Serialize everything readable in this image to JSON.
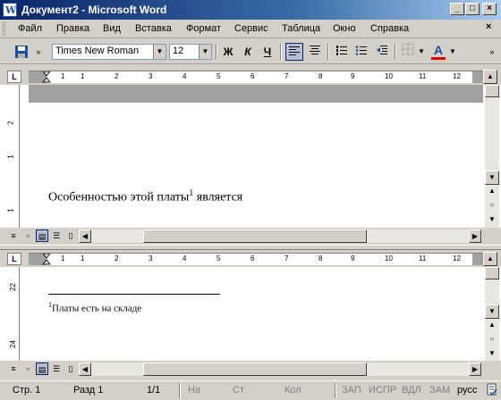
{
  "window": {
    "title": "Документ2 - Microsoft Word",
    "app_icon_letter": "W",
    "minimize": "_",
    "maximize": "□",
    "close": "×"
  },
  "menu": {
    "items": [
      {
        "label": "Файл"
      },
      {
        "label": "Правка"
      },
      {
        "label": "Вид"
      },
      {
        "label": "Вставка"
      },
      {
        "label": "Формат"
      },
      {
        "label": "Сервис"
      },
      {
        "label": "Таблица"
      },
      {
        "label": "Окно"
      },
      {
        "label": "Справка"
      }
    ],
    "close_doc": "×"
  },
  "toolbar": {
    "font_name": "Times New Roman",
    "font_size": "12",
    "bold": "Ж",
    "italic": "К",
    "underline": "Ч",
    "font_color": "A",
    "font_color_hex": "#e00000"
  },
  "ruler": {
    "tab_marker": "L",
    "numbers": [
      "1",
      "1",
      "2",
      "3",
      "4",
      "5",
      "6",
      "7",
      "8",
      "9",
      "10",
      "11",
      "12"
    ]
  },
  "top_pane": {
    "vruler_numbers": [
      "2",
      "1",
      "1"
    ],
    "text": "Особенностью этой платы",
    "footnote_ref": "1",
    "text_after": " является"
  },
  "bottom_pane": {
    "vruler_numbers": [
      "22",
      "24"
    ],
    "footnote_mark": "1",
    "footnote_text": "Платы есть на складе"
  },
  "status": {
    "page": "Стр.  1",
    "section": "Разд  1",
    "pages": "1/1",
    "at": "На",
    "line": "Ст",
    "col": "Кол",
    "rec": "ЗАП",
    "trk": "ИСПР",
    "ext": "ВДЛ",
    "ovr": "ЗАМ",
    "lang": "русс"
  }
}
